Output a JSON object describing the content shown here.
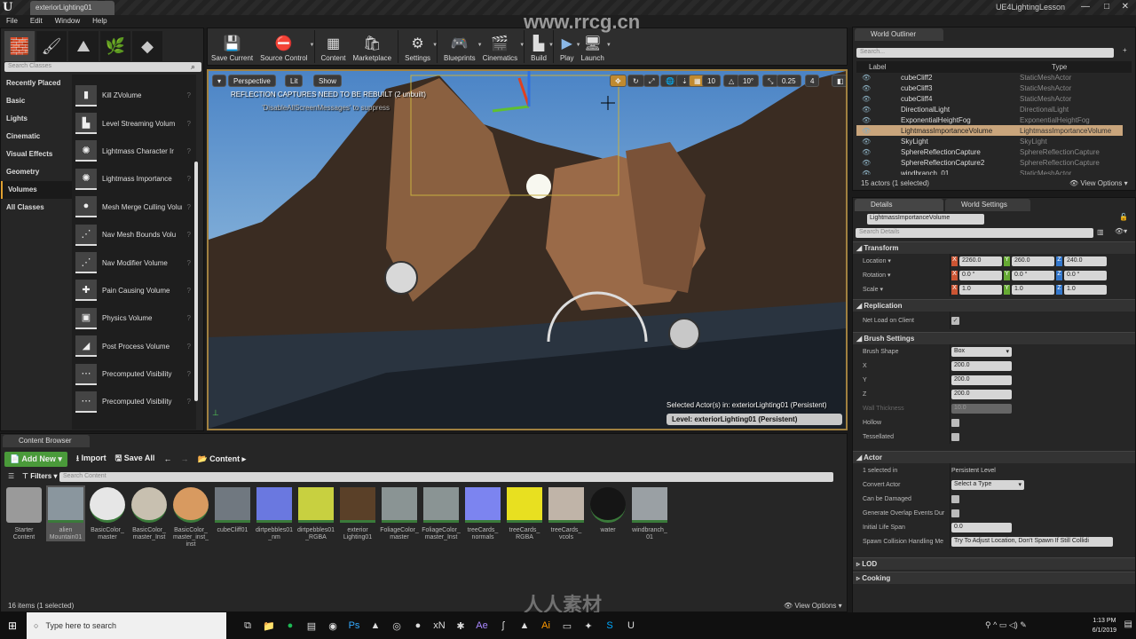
{
  "window": {
    "doc_tab": "exteriorLighting01",
    "project": "UE4LightingLesson",
    "watermark": "www.rrcg.cn",
    "brand_watermark": "人人素材"
  },
  "menu": [
    "File",
    "Edit",
    "Window",
    "Help"
  ],
  "modes": {
    "search_placeholder": "Search Classes",
    "categories": [
      "Recently Placed",
      "Basic",
      "Lights",
      "Cinematic",
      "Visual Effects",
      "Geometry",
      "Volumes",
      "All Classes"
    ],
    "active_category": "Volumes",
    "items": [
      "Kill ZVolume",
      "Level Streaming Volum",
      "Lightmass Character Ir",
      "Lightmass Importance",
      "Mesh Merge Culling Volum",
      "Nav Mesh Bounds Volu",
      "Nav Modifier Volume",
      "Pain Causing Volume",
      "Physics Volume",
      "Post Process Volume",
      "Precomputed Visibility",
      "Precomputed Visibility"
    ]
  },
  "toolbar": [
    "Save Current",
    "Source Control",
    "Content",
    "Marketplace",
    "Settings",
    "Blueprints",
    "Cinematics",
    "Build",
    "Play",
    "Launch"
  ],
  "viewport": {
    "view_mode": "Perspective",
    "lighting": "Lit",
    "show": "Show",
    "grid_snap": "10",
    "rot_snap": "10°",
    "scale_snap": "0.25",
    "cam_speed": "4",
    "warning": "REFLECTION CAPTURES NEED TO BE REBUILT (2 unbuilt)",
    "warning_sub": "'DisableAllScreenMessages' to suppress",
    "selected_actors": "Selected Actor(s) in:  exteriorLighting01 (Persistent)",
    "level": "Level:  exteriorLighting01 (Persistent)"
  },
  "outliner": {
    "tab": "World Outliner",
    "search_placeholder": "Search...",
    "col_label": "Label",
    "col_type": "Type",
    "rows": [
      {
        "label": "cubeCliff2",
        "type": "StaticMeshActor"
      },
      {
        "label": "cubeCliff3",
        "type": "StaticMeshActor"
      },
      {
        "label": "cubeCliff4",
        "type": "StaticMeshActor"
      },
      {
        "label": "DirectionalLight",
        "type": "DirectionalLight"
      },
      {
        "label": "ExponentialHeightFog",
        "type": "ExponentialHeightFog"
      },
      {
        "label": "LightmassImportanceVolume",
        "type": "LightmassImportanceVolume",
        "selected": true
      },
      {
        "label": "SkyLight",
        "type": "SkyLight"
      },
      {
        "label": "SphereReflectionCapture",
        "type": "SphereReflectionCapture"
      },
      {
        "label": "SphereReflectionCapture2",
        "type": "SphereReflectionCapture"
      },
      {
        "label": "windbranch_01",
        "type": "StaticMeshActor"
      }
    ],
    "status": "15 actors (1 selected)",
    "view_options": "View Options"
  },
  "details": {
    "tab": "Details",
    "tab2": "World Settings",
    "actor_name": "LightmassImportanceVolume",
    "search_placeholder": "Search Details",
    "transform": {
      "title": "Transform",
      "location_label": "Location",
      "rotation_label": "Rotation",
      "scale_label": "Scale",
      "location": [
        "2260.0",
        "260.0",
        "240.0"
      ],
      "rotation": [
        "0.0 °",
        "0.0 °",
        "0.0 °"
      ],
      "scale": [
        "1.0",
        "1.0",
        "1.0"
      ]
    },
    "replication": {
      "title": "Replication",
      "net_load_label": "Net Load on Client",
      "net_load": true
    },
    "brush": {
      "title": "Brush Settings",
      "shape_label": "Brush Shape",
      "shape": "Box",
      "x_label": "X",
      "x": "200.0",
      "y_label": "Y",
      "y": "200.0",
      "z_label": "Z",
      "z": "200.0",
      "wall_label": "Wall Thickness",
      "wall": "10.0",
      "hollow_label": "Hollow",
      "tess_label": "Tessellated"
    },
    "actor": {
      "title": "Actor",
      "sel_label": "1 selected in",
      "sel_value": "Persistent Level",
      "convert_label": "Convert Actor",
      "convert": "Select a Type",
      "damaged_label": "Can be Damaged",
      "overlap_label": "Generate Overlap Events Dur",
      "life_label": "Initial Life Span",
      "life": "0.0",
      "spawn_label": "Spawn Collision Handling Me",
      "spawn": "Try To Adjust Location, Don't Spawn If Still Collidi"
    },
    "lod": "LOD",
    "cooking": "Cooking"
  },
  "content": {
    "tab": "Content Browser",
    "add_new": "Add New",
    "import": "Import",
    "save_all": "Save All",
    "path": "Content",
    "filters": "Filters",
    "search_placeholder": "Search Content",
    "assets": [
      {
        "name": "Starter Content",
        "color": "#9a9a9a"
      },
      {
        "name": "alien Mountain01",
        "color": "#8a969e"
      },
      {
        "name": "BasicColor_ master",
        "color": "#e6e6e6"
      },
      {
        "name": "BasicColor_ master_Inst",
        "color": "#c8c0b0"
      },
      {
        "name": "BasicColor_ master_inst_ inst",
        "color": "#d89a60"
      },
      {
        "name": "cubeCliff01",
        "color": "#707880"
      },
      {
        "name": "dirtpebbles01 _nm",
        "color": "#6a78e0"
      },
      {
        "name": "dirtpebbles01 _RGBA",
        "color": "#c8d040"
      },
      {
        "name": "exterior Lighting01",
        "color": "#5a4028"
      },
      {
        "name": "FoliageColor_ master",
        "color": "#8a9494"
      },
      {
        "name": "FoliageColor_ master_Inst",
        "color": "#8a9494"
      },
      {
        "name": "treeCards_ normals",
        "color": "#7c84f0"
      },
      {
        "name": "treeCards_ RGBA",
        "color": "#e8e020"
      },
      {
        "name": "treeCards_ vcols",
        "color": "#c0b4a8"
      },
      {
        "name": "water",
        "color": "#151515"
      },
      {
        "name": "windbranch_ 01",
        "color": "#9aa0a4"
      }
    ],
    "status": "16 items (1 selected)",
    "view_options": "View Options"
  },
  "taskbar": {
    "search_placeholder": "Type here to search",
    "time": "1:13 PM",
    "date": "6/1/2019"
  }
}
